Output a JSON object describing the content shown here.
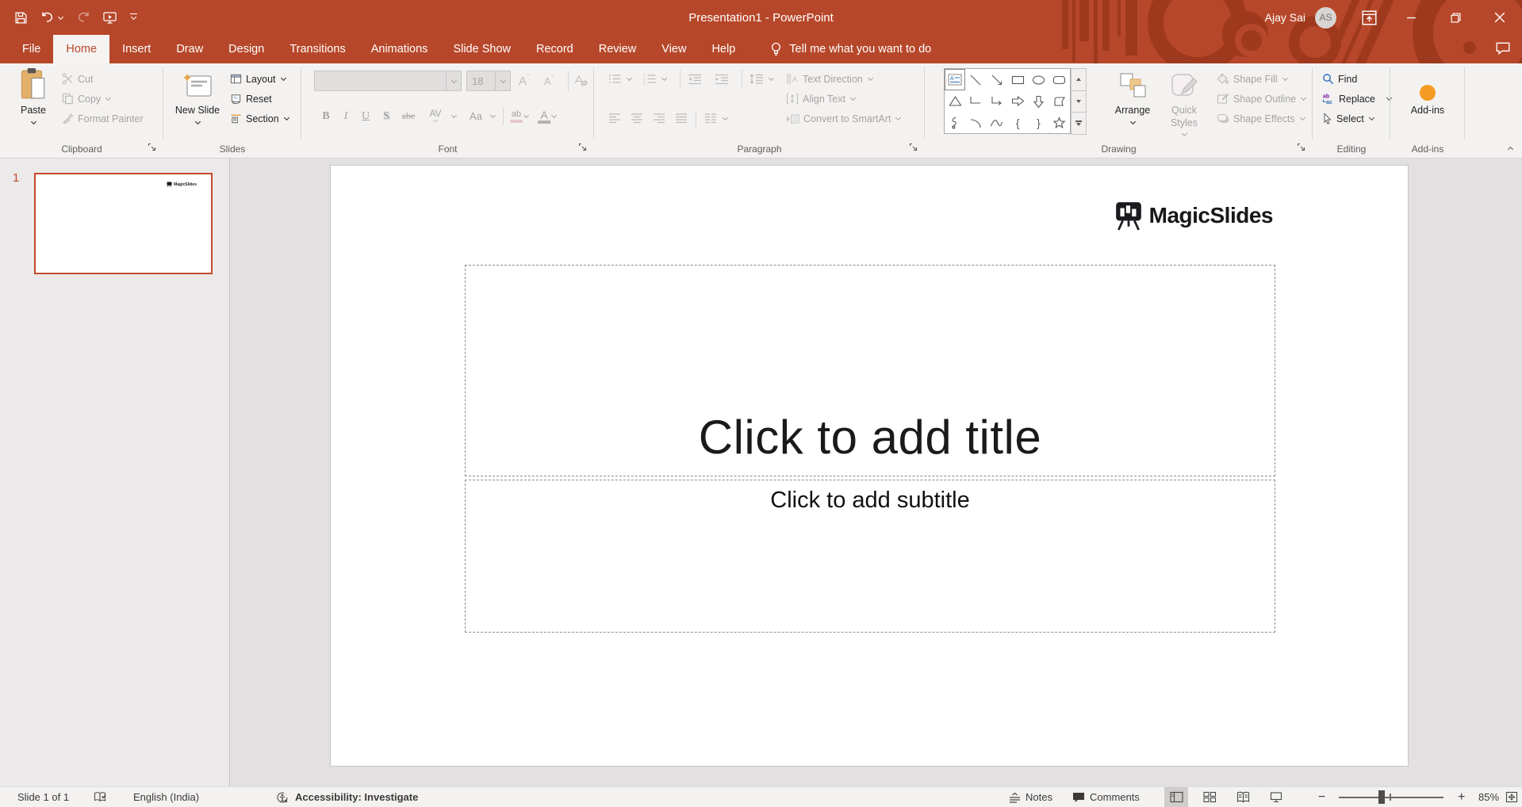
{
  "titlebar": {
    "title": "Presentation1 - PowerPoint",
    "user": {
      "name": "Ajay Sai",
      "initials": "AS"
    }
  },
  "tabs": {
    "items": [
      {
        "label": "File"
      },
      {
        "label": "Home"
      },
      {
        "label": "Insert"
      },
      {
        "label": "Draw"
      },
      {
        "label": "Design"
      },
      {
        "label": "Transitions"
      },
      {
        "label": "Animations"
      },
      {
        "label": "Slide Show"
      },
      {
        "label": "Record"
      },
      {
        "label": "Review"
      },
      {
        "label": "View"
      },
      {
        "label": "Help"
      }
    ],
    "active": "Home",
    "tell_me": "Tell me what you want to do"
  },
  "ribbon": {
    "groups": {
      "clipboard": {
        "label": "Clipboard",
        "paste": "Paste",
        "cut": "Cut",
        "copy": "Copy",
        "format_painter": "Format Painter"
      },
      "slides": {
        "label": "Slides",
        "new_slide": "New Slide",
        "layout": "Layout",
        "reset": "Reset",
        "section": "Section"
      },
      "font": {
        "label": "Font",
        "font_name": "",
        "font_size": "18",
        "bold": "B",
        "italic": "I",
        "underline": "U",
        "shadow": "S",
        "strikethrough": "abc",
        "char_spacing": "AV",
        "change_case": "Aa",
        "highlight": "ab",
        "font_color": "A"
      },
      "paragraph": {
        "label": "Paragraph",
        "text_direction": "Text Direction",
        "align_text": "Align Text",
        "convert_smartart": "Convert to SmartArt"
      },
      "drawing": {
        "label": "Drawing",
        "arrange": "Arrange",
        "quick_styles": "Quick Styles",
        "shape_fill": "Shape Fill",
        "shape_outline": "Shape Outline",
        "shape_effects": "Shape Effects",
        "shapes": [
          "text-box",
          "line",
          "arrow",
          "rectangle",
          "oval",
          "rounded-rectangle",
          "triangle",
          "elbow-connector",
          "elbow-arrow-connector",
          "arrow-right",
          "arrow-down",
          "snip-corner",
          "scribble",
          "arc",
          "curve",
          "left-brace",
          "right-brace",
          "star"
        ]
      },
      "editing": {
        "label": "Editing",
        "find": "Find",
        "replace": "Replace",
        "select": "Select"
      },
      "addins": {
        "label": "Add-ins",
        "button": "Add-ins"
      }
    }
  },
  "thumbnails": {
    "slide_number": "1"
  },
  "slide": {
    "brand": "MagicSlides",
    "title_placeholder": "Click to add title",
    "subtitle_placeholder": "Click to add subtitle"
  },
  "statusbar": {
    "slide_counter": "Slide 1 of 1",
    "language": "English (India)",
    "accessibility": "Accessibility: Investigate",
    "notes": "Notes",
    "comments": "Comments",
    "zoom_out": "−",
    "zoom_in": "+",
    "zoom_level": "85%"
  },
  "colors": {
    "accent": "#B7472A",
    "accent_dark": "#8F3017",
    "active_tab_text": "#B7472A",
    "disabled_text": "#A6A4A2",
    "addin_dot": "#F59A23",
    "selection_border": "#C4492C",
    "find_icon_blue": "#2B6CB8",
    "replace_icon_purple": "#7719AA"
  }
}
